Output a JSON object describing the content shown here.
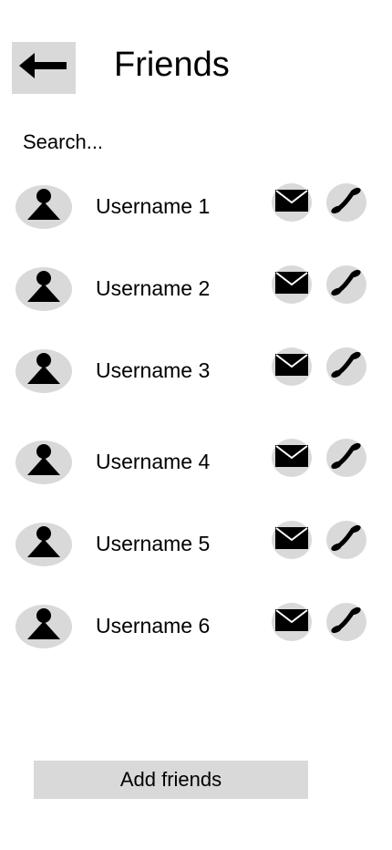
{
  "header": {
    "title": "Friends",
    "back_icon": "arrow-left-icon"
  },
  "search": {
    "placeholder": "Search..."
  },
  "friends": [
    {
      "username": "Username 1"
    },
    {
      "username": "Username 2"
    },
    {
      "username": "Username 3"
    },
    {
      "username": "Username 4"
    },
    {
      "username": "Username 5"
    },
    {
      "username": "Username 6"
    }
  ],
  "row_icons": {
    "avatar": "person-icon",
    "message": "envelope-icon",
    "call": "phone-icon"
  },
  "footer": {
    "add_label": "Add friends"
  },
  "colors": {
    "button_gray": "#d9d9d9",
    "text": "#000000",
    "background": "#ffffff"
  }
}
